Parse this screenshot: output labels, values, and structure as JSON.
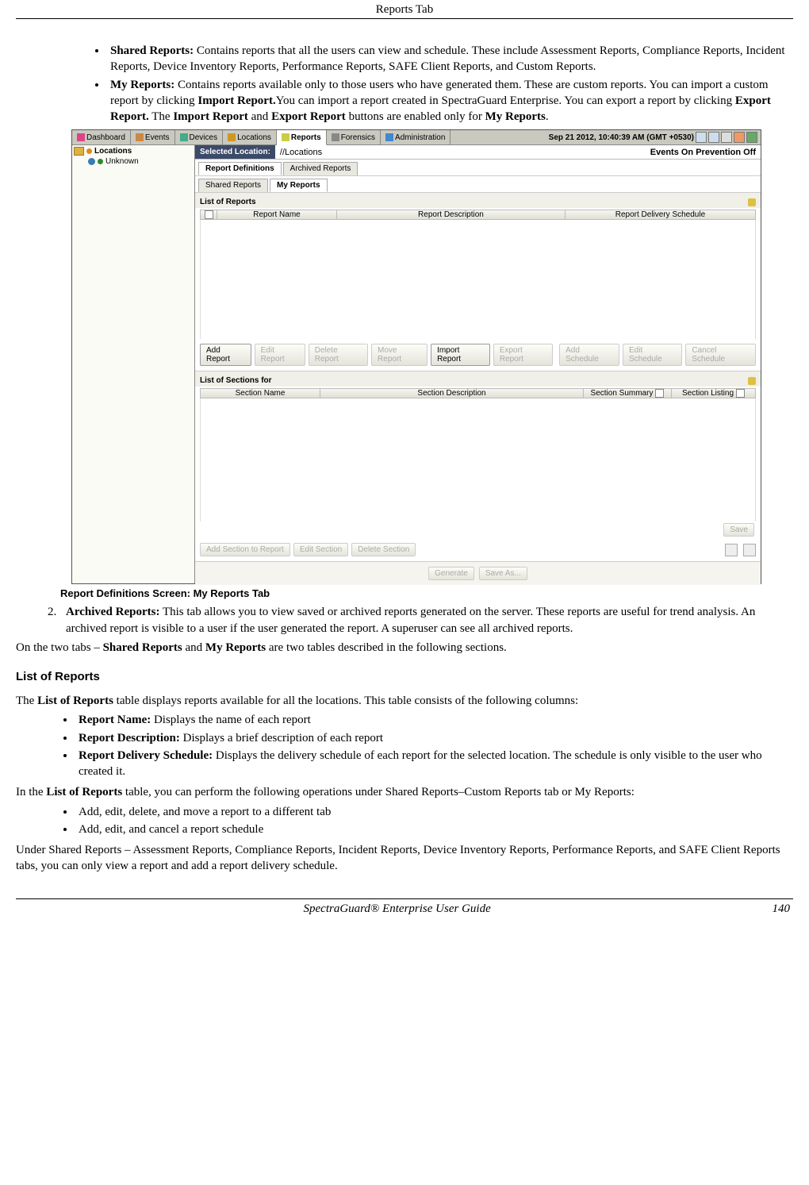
{
  "header": {
    "title": "Reports Tab"
  },
  "intro_bullets": [
    {
      "bold": "Shared Reports:",
      "text": " Contains reports that all the users can view and schedule. These include Assessment Reports, Compliance Reports, Incident Reports, Device Inventory Reports, Performance Reports, SAFE Client Reports, and Custom Reports."
    },
    {
      "bold": "My Reports:",
      "html_parts": [
        " Contains reports available only to those users who have generated them. These are custom reports. You can import a custom report by clicking ",
        "Import Report.",
        "You can import a report created in SpectraGuard Enterprise. You can export a report by clicking ",
        "Export Report.",
        "  The ",
        "Import Report",
        " and ",
        "Export Report",
        " buttons are enabled only for ",
        "My Reports",
        "."
      ]
    }
  ],
  "screenshot": {
    "toolbar": {
      "tabs": [
        "Dashboard",
        "Events",
        "Devices",
        "Locations",
        "Reports",
        "Forensics",
        "Administration"
      ],
      "active_index": 4,
      "datetime": "Sep 21 2012, 10:40:39 AM (GMT +0530)"
    },
    "sidebar": {
      "root": "Locations",
      "child": "Unknown"
    },
    "selected_location": {
      "label": "Selected Location:",
      "path": "//Locations",
      "events": "Events On Prevention Off"
    },
    "subtabs_row1": {
      "items": [
        "Report Definitions",
        "Archived Reports"
      ],
      "active": 0
    },
    "subtabs_row2": {
      "items": [
        "Shared Reports",
        "My Reports"
      ],
      "active": 1
    },
    "list_of_reports": {
      "title": "List of Reports",
      "columns": [
        "Report Name ",
        "Report Description",
        "Report Delivery Schedule"
      ]
    },
    "report_buttons": {
      "left": [
        {
          "label": "Add Report",
          "enabled": true
        },
        {
          "label": "Edit Report",
          "enabled": false
        },
        {
          "label": "Delete Report",
          "enabled": false
        },
        {
          "label": "Move Report",
          "enabled": false
        },
        {
          "label": "Import Report",
          "enabled": true
        },
        {
          "label": "Export Report",
          "enabled": false
        }
      ],
      "right": [
        {
          "label": "Add Schedule",
          "enabled": false
        },
        {
          "label": "Edit Schedule",
          "enabled": false
        },
        {
          "label": "Cancel Schedule",
          "enabled": false
        }
      ]
    },
    "list_of_sections": {
      "title": "List of Sections for",
      "columns": [
        "Section Name",
        "Section Description",
        "Section Summary",
        "Section Listing"
      ]
    },
    "save_button": "Save",
    "section_buttons": [
      {
        "label": "Add Section to Report",
        "enabled": false
      },
      {
        "label": "Edit Section",
        "enabled": false
      },
      {
        "label": "Delete Section",
        "enabled": false
      }
    ],
    "bottom_buttons": [
      {
        "label": "Generate",
        "enabled": false
      },
      {
        "label": "Save As...",
        "enabled": false
      }
    ]
  },
  "caption": "Report Definitions Screen: My Reports Tab",
  "numbered_item": {
    "num": "2.",
    "bold": "Archived Reports:",
    "text": " This tab allows you to view saved or archived reports generated on the server. These reports are useful for trend analysis. An archived report is visible to a user if the user generated the report. A superuser can see all archived reports."
  },
  "para_after_num_parts": [
    "On the two tabs – ",
    "Shared Reports",
    " and ",
    "My Reports",
    " are two tables described in the following sections."
  ],
  "section_heading": "List of Reports",
  "para_lor_parts": [
    "The ",
    "List of Reports",
    " table displays reports available for all the locations. This table consists of the following columns:"
  ],
  "lor_bullets": [
    {
      "bold": "Report Name:",
      "text": " Displays the name of each report"
    },
    {
      "bold": "Report Description:",
      "text": " Displays a brief description of each report"
    },
    {
      "bold": "Report Delivery Schedule:",
      "text": " Displays the delivery schedule of each report for the selected location. The schedule is only visible to the user who created it."
    }
  ],
  "para_ops_parts": [
    "In the ",
    "List of Reports",
    " table, you can perform the following operations under Shared Reports–Custom Reports tab or My Reports:"
  ],
  "ops_bullets": [
    "Add, edit, delete, and move a report to a different tab",
    "Add, edit, and cancel a report schedule"
  ],
  "para_under": "Under Shared Reports – Assessment Reports, Compliance Reports, Incident Reports, Device Inventory Reports, Performance Reports, and SAFE Client Reports tabs, you can only view a report and add a report delivery schedule.",
  "footer": {
    "left": "SpectraGuard® Enterprise User Guide",
    "right": "140"
  }
}
